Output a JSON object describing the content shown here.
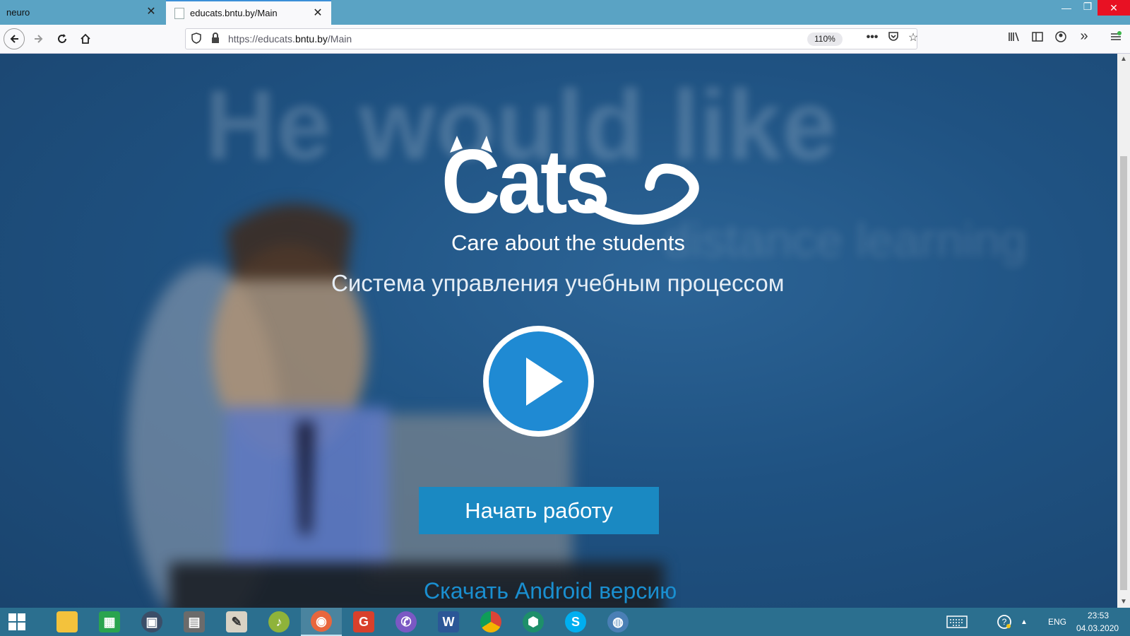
{
  "browser": {
    "tabs": [
      {
        "label": "neuro",
        "active": false
      },
      {
        "label": "educats.bntu.by/Main",
        "active": true
      }
    ],
    "url_prefix": "https://educats.",
    "url_domain": "bntu.by",
    "url_suffix": "/Main",
    "zoom": "110%"
  },
  "page": {
    "background_headline": "He would like",
    "background_sub": "distance learning",
    "logo_text": "Cats",
    "tagline": "Care about the students",
    "subtitle": "Система управления учебным процессом",
    "start_button": "Начать работу",
    "android_link": "Скачать Android версию",
    "colors": {
      "accent": "#1a89c2",
      "play": "#1f8ad3",
      "background": "#1f4d7a",
      "link": "#1a8fd0"
    }
  },
  "taskbar": {
    "apps": [
      "windows-start",
      "file-explorer",
      "store",
      "media-player",
      "scanner",
      "notepad",
      "itunes",
      "firefox",
      "foxit",
      "viber",
      "word",
      "chrome",
      "vpn",
      "skype",
      "network"
    ],
    "language": "ENG",
    "time": "23:53",
    "date": "04.03.2020"
  }
}
